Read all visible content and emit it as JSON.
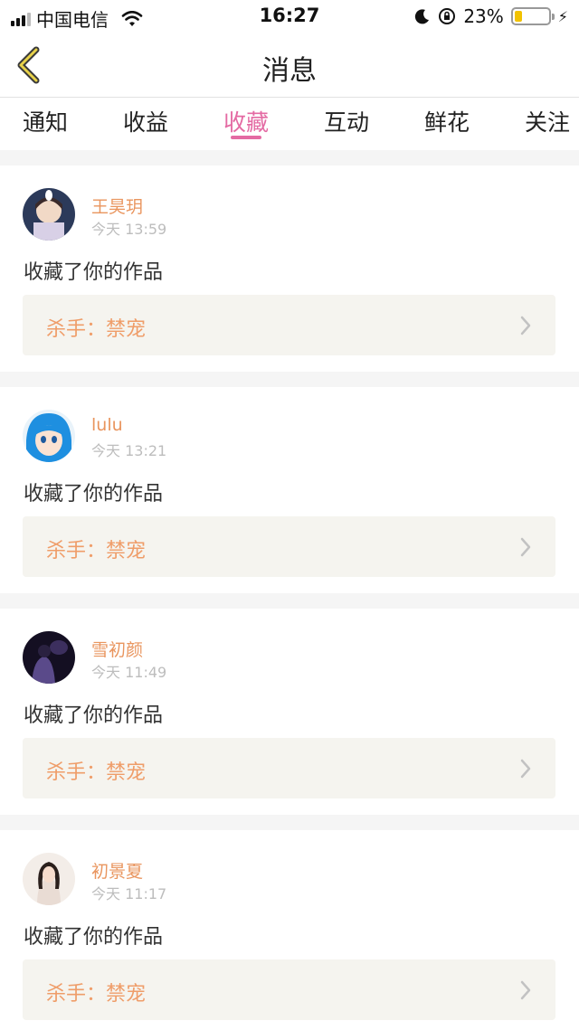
{
  "status_bar": {
    "carrier": "中国电信",
    "time": "16:27",
    "battery": "23%",
    "battery_level": 0.23
  },
  "nav": {
    "title": "消息",
    "back_icon": "chevron-left-icon",
    "accent_color": "#e8d24a"
  },
  "tabs": [
    {
      "label": "通知",
      "active": false
    },
    {
      "label": "收益",
      "active": false
    },
    {
      "label": "收藏",
      "active": true
    },
    {
      "label": "互动",
      "active": false
    },
    {
      "label": "鲜花",
      "active": false
    },
    {
      "label": "关注",
      "active": false
    }
  ],
  "colors": {
    "active_tab": "#e46aa3",
    "username": "#e9955e",
    "work_title": "#ef9d69"
  },
  "messages": [
    {
      "username": "王昊玥",
      "time": "今天 13:59",
      "action": "收藏了你的作品",
      "work": "杀手：禁宠",
      "avatar": "anime-boy-avatar"
    },
    {
      "username": "lulu",
      "time": "今天 13:21",
      "action": "收藏了你的作品",
      "work": "杀手：禁宠",
      "avatar": "blue-hair-anime-avatar"
    },
    {
      "username": "雪初颜",
      "time": "今天 11:49",
      "action": "收藏了你的作品",
      "work": "杀手：禁宠",
      "avatar": "dark-silhouette-avatar"
    },
    {
      "username": "初景夏",
      "time": "今天 11:17",
      "action": "收藏了你的作品",
      "work": "杀手：禁宠",
      "avatar": "girl-photo-avatar"
    }
  ]
}
